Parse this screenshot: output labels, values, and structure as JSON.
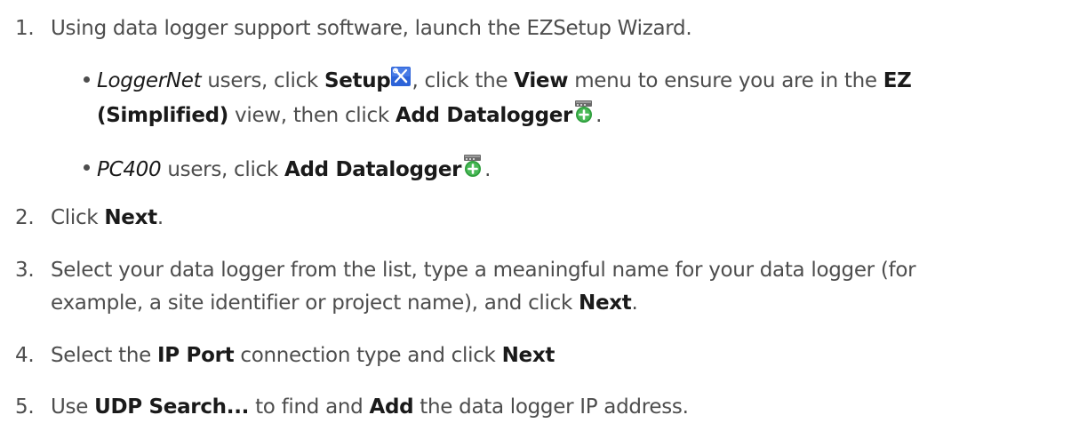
{
  "steps": [
    {
      "number": "1.",
      "text_a": "Using data logger support software, launch the EZSetup Wizard."
    },
    {
      "number": "2.",
      "text_a": "Click ",
      "b1": "Next",
      "text_b": "."
    },
    {
      "number": "3.",
      "line1": "Select your data logger from the list, type a meaningful name for your data logger (for",
      "line2_a": "example, a site identifier or project name), and click ",
      "line2_b1": "Next",
      "line2_b": "."
    },
    {
      "number": "4.",
      "text_a": "Select the ",
      "b1": "IP Port",
      "text_b": " connection type and click ",
      "b2": "Next"
    },
    {
      "number": "5.",
      "text_a": "Use ",
      "b1": "UDP Search...",
      "text_b": " to find and ",
      "b2": "Add",
      "text_c": " the data logger IP address."
    }
  ],
  "bullets": [
    {
      "i1": "LoggerNet",
      "t1": " users, click ",
      "b1": "Setup",
      "t2": ", click the ",
      "b2": "View",
      "t3": " menu to ensure you are in the ",
      "b3": "EZ",
      "line2_b1": "(Simplified)",
      "line2_t1": " view, then click ",
      "line2_b2": "Add Datalogger",
      "line2_t2": "."
    },
    {
      "i1": "PC400",
      "t1": " users, click ",
      "b1": "Add Datalogger",
      "t2": "."
    }
  ],
  "icons": {
    "setup": "setup-tools-icon",
    "add_datalogger": "add-datalogger-icon",
    "accent_blue": "#2d63d8",
    "accent_green": "#2e9e3c"
  }
}
